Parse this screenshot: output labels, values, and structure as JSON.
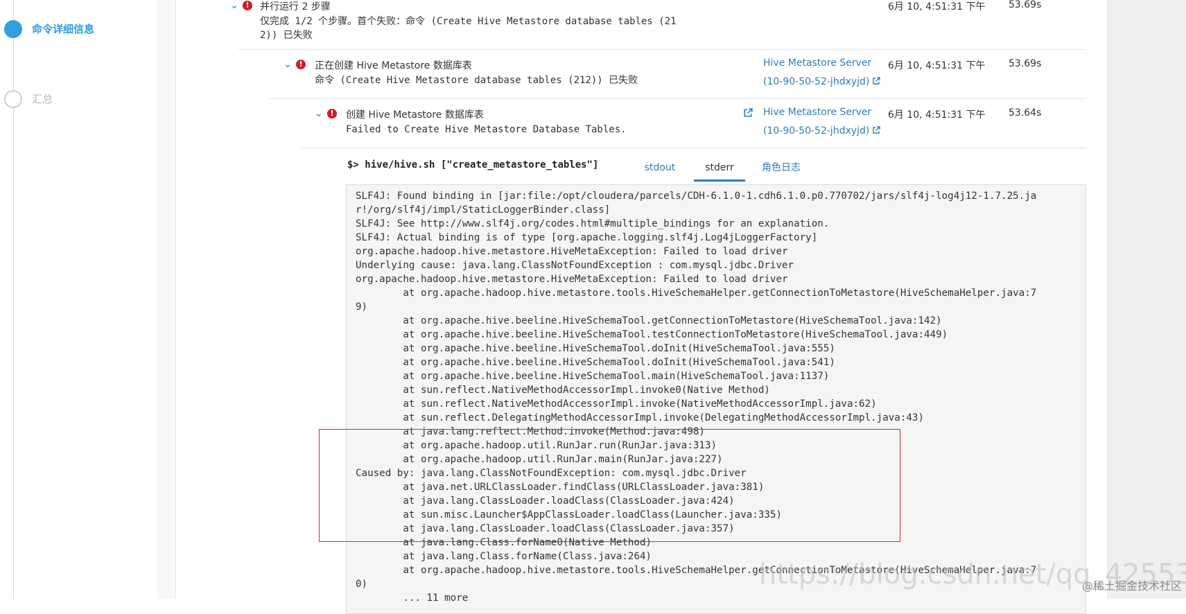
{
  "steps": [
    {
      "label": "命令详细信息",
      "active": true
    },
    {
      "label": "汇总",
      "active": false
    }
  ],
  "rows": [
    {
      "title": "并行运行 2 步骤",
      "desc": "仅完成 1/2 个步骤。首个失败：命令 (Create Hive Metastore database tables (21\n2)) 已失败",
      "host_line1": "",
      "host_line2": "",
      "time": "6月 10, 4:51:31 下午",
      "duration": "53.69s"
    },
    {
      "title": "正在创建 Hive Metastore 数据库表",
      "desc": "命令 (Create Hive Metastore database tables (212)) 已失败",
      "host_line1": "Hive Metastore Server",
      "host_line2": "(10-90-50-52-jhdxyjd)",
      "time": "6月 10, 4:51:31 下午",
      "duration": "53.69s"
    },
    {
      "title": "创建 Hive Metastore 数据库表",
      "desc": "Failed to Create Hive Metastore Database Tables.",
      "host_line1": "Hive Metastore Server",
      "host_line2": "(10-90-50-52-jhdxyjd)",
      "time": "6月 10, 4:51:31 下午",
      "duration": "53.64s"
    }
  ],
  "command": {
    "prompt": "$>",
    "text": "hive/hive.sh [\"create_metastore_tables\"]"
  },
  "tabs": [
    "stdout",
    "stderr",
    "角色日志"
  ],
  "active_tab": "stderr",
  "log_lines": [
    "SLF4J: Found binding in [jar:file:/opt/cloudera/parcels/CDH-6.1.0-1.cdh6.1.0.p0.770702/jars/slf4j-log4j12-1.7.25.ja",
    "r!/org/slf4j/impl/StaticLoggerBinder.class]",
    "SLF4J: See http://www.slf4j.org/codes.html#multiple_bindings for an explanation.",
    "SLF4J: Actual binding is of type [org.apache.logging.slf4j.Log4jLoggerFactory]",
    "org.apache.hadoop.hive.metastore.HiveMetaException: Failed to load driver",
    "Underlying cause: java.lang.ClassNotFoundException : com.mysql.jdbc.Driver",
    "org.apache.hadoop.hive.metastore.HiveMetaException: Failed to load driver",
    "        at org.apache.hadoop.hive.metastore.tools.HiveSchemaHelper.getConnectionToMetastore(HiveSchemaHelper.java:7",
    "9)",
    "        at org.apache.hive.beeline.HiveSchemaTool.getConnectionToMetastore(HiveSchemaTool.java:142)",
    "        at org.apache.hive.beeline.HiveSchemaTool.testConnectionToMetastore(HiveSchemaTool.java:449)",
    "        at org.apache.hive.beeline.HiveSchemaTool.doInit(HiveSchemaTool.java:555)",
    "        at org.apache.hive.beeline.HiveSchemaTool.doInit(HiveSchemaTool.java:541)",
    "        at org.apache.hive.beeline.HiveSchemaTool.main(HiveSchemaTool.java:1137)",
    "        at sun.reflect.NativeMethodAccessorImpl.invoke0(Native Method)",
    "        at sun.reflect.NativeMethodAccessorImpl.invoke(NativeMethodAccessorImpl.java:62)",
    "        at sun.reflect.DelegatingMethodAccessorImpl.invoke(DelegatingMethodAccessorImpl.java:43)",
    "        at java.lang.reflect.Method.invoke(Method.java:498)",
    "        at org.apache.hadoop.util.RunJar.run(RunJar.java:313)",
    "        at org.apache.hadoop.util.RunJar.main(RunJar.java:227)",
    "Caused by: java.lang.ClassNotFoundException: com.mysql.jdbc.Driver",
    "        at java.net.URLClassLoader.findClass(URLClassLoader.java:381)",
    "        at java.lang.ClassLoader.loadClass(ClassLoader.java:424)",
    "        at sun.misc.Launcher$AppClassLoader.loadClass(Launcher.java:335)",
    "        at java.lang.ClassLoader.loadClass(ClassLoader.java:357)",
    "        at java.lang.Class.forName0(Native Method)",
    "        at java.lang.Class.forName(Class.java:264)",
    "        at org.apache.hadoop.hive.metastore.tools.HiveSchemaHelper.getConnectionToMetastore(HiveSchemaHelper.java:7",
    "0)",
    "        ... 11 more"
  ],
  "watermark": "@稀土掘金技术社区",
  "watermark_url": "https://blog.csdn.net/qq_42553",
  "colors": {
    "accent": "#2e9fe0",
    "link": "#2e7db8",
    "error": "#c9202b",
    "highlight": "#cc2a2a"
  },
  "icons": {
    "chevron": "chevron-down-icon",
    "error": "error-icon",
    "external": "external-link-icon"
  }
}
